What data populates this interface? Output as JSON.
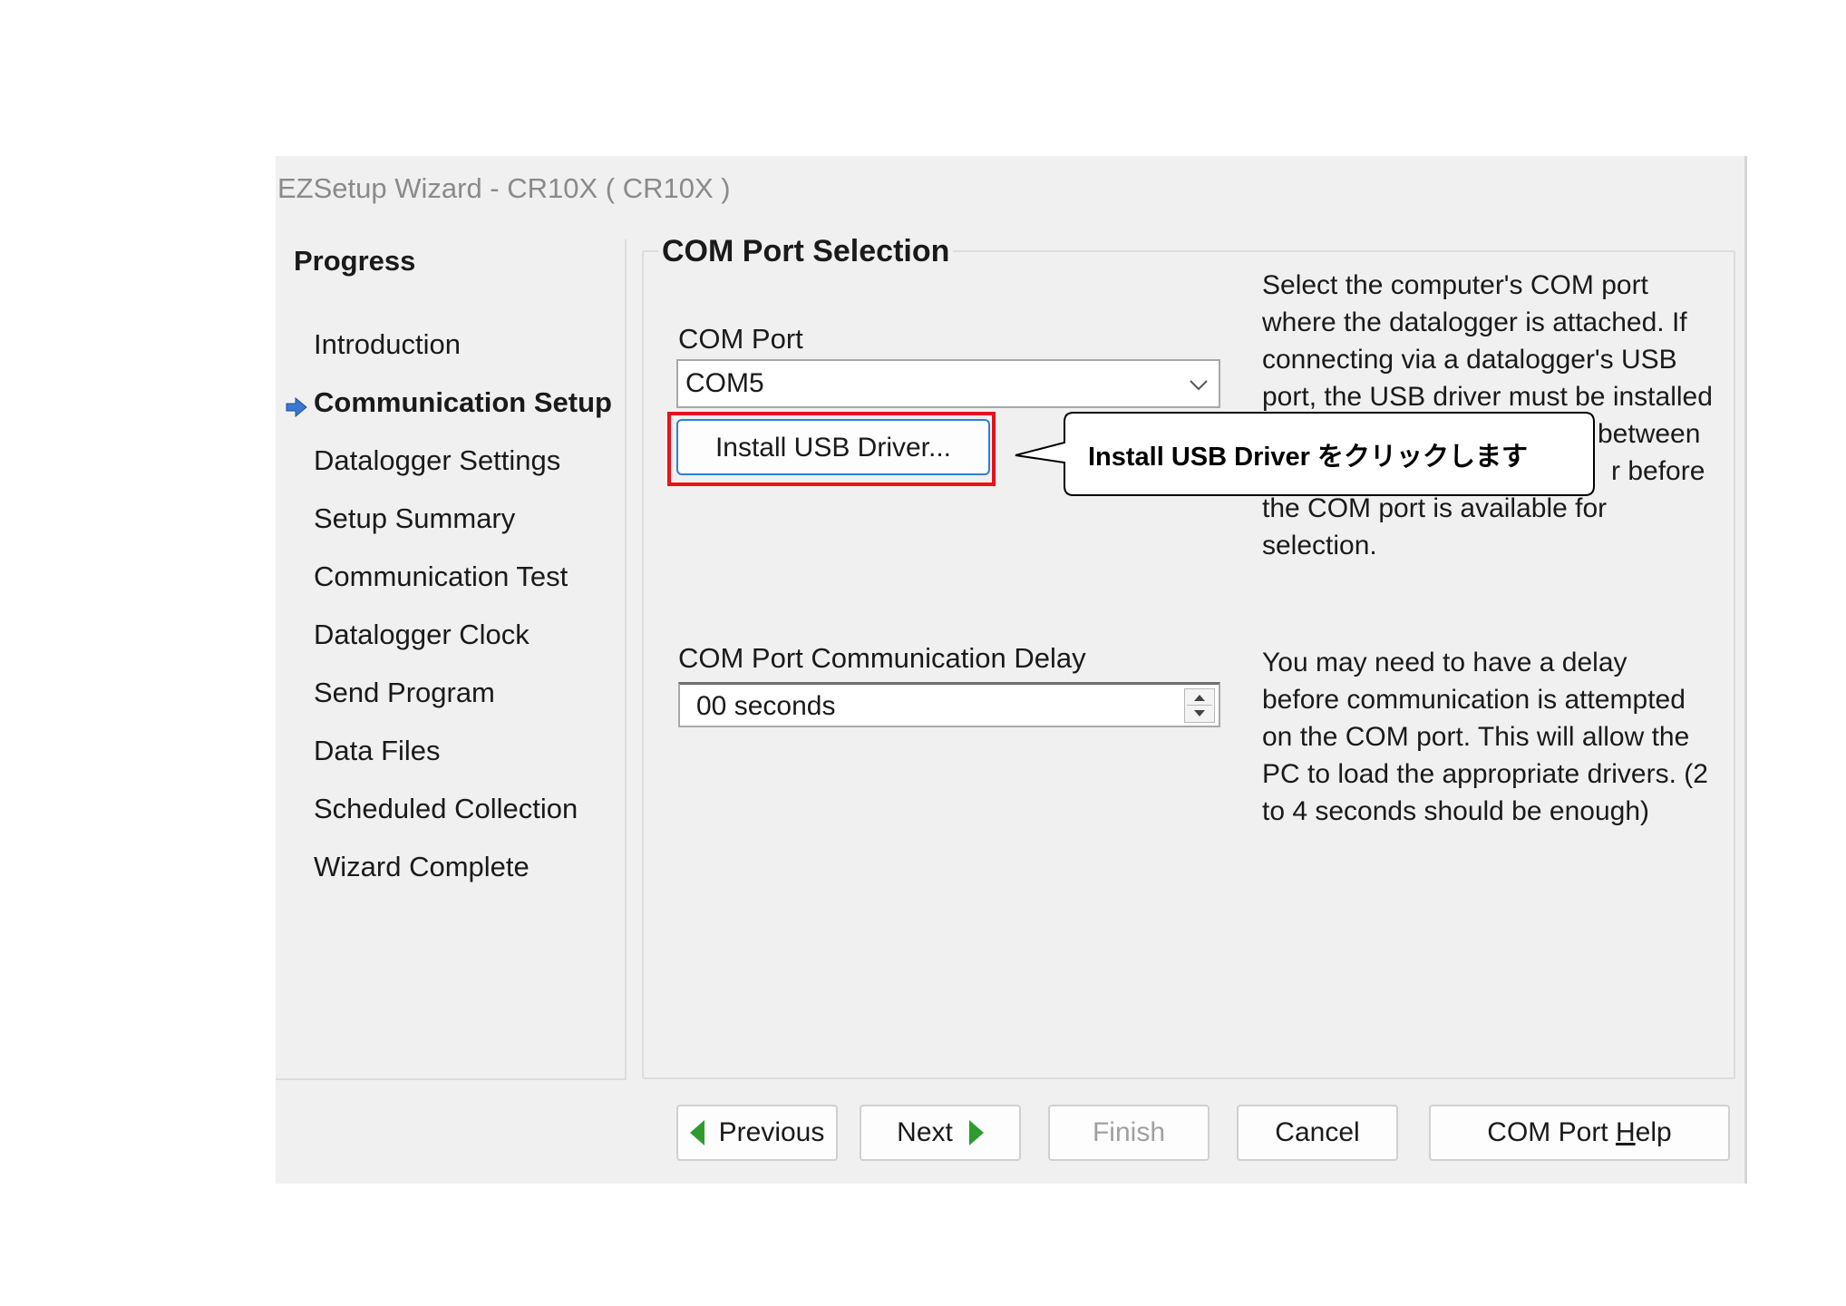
{
  "window": {
    "title": "EZSetup Wizard - CR10X ( CR10X )"
  },
  "progress": {
    "heading": "Progress",
    "steps": [
      {
        "label": "Introduction",
        "active": false
      },
      {
        "label": "Communication Setup",
        "active": true
      },
      {
        "label": "Datalogger Settings",
        "active": false
      },
      {
        "label": "Setup Summary",
        "active": false
      },
      {
        "label": "Communication Test",
        "active": false
      },
      {
        "label": "Datalogger Clock",
        "active": false
      },
      {
        "label": "Send Program",
        "active": false
      },
      {
        "label": "Data Files",
        "active": false
      },
      {
        "label": "Scheduled Collection",
        "active": false
      },
      {
        "label": "Wizard Complete",
        "active": false
      }
    ],
    "active_icon": "right-arrow-icon"
  },
  "main": {
    "section_title": "COM Port Selection",
    "com_port": {
      "label": "COM Port",
      "value": "COM5"
    },
    "install_button_label": "Install USB Driver...",
    "callout": {
      "text": "Install USB Driver をクリックします"
    },
    "com_port_help": [
      "Select the computer's COM port",
      "where the datalogger is attached.  If",
      "connecting via a datalogger's USB",
      "port, the USB driver must be installed",
      "between",
      "r before",
      "the COM port is available for",
      "selection."
    ],
    "delay": {
      "label": "COM Port Communication Delay",
      "value": "00 seconds"
    },
    "delay_help": [
      "You may need to have a delay",
      "before communication is attempted",
      "on the COM port.  This will allow the",
      "PC to load the appropriate drivers. (2",
      "to 4 seconds should be enough)"
    ]
  },
  "buttons": {
    "previous": "Previous",
    "next": "Next",
    "finish": "Finish",
    "cancel": "Cancel",
    "help_prefix": "COM Port ",
    "help_underlined": "H",
    "help_suffix": "elp"
  },
  "colors": {
    "highlight": "#e5141b",
    "accent": "#2f7ed8",
    "nav_arrow": "#2e9b2e"
  }
}
